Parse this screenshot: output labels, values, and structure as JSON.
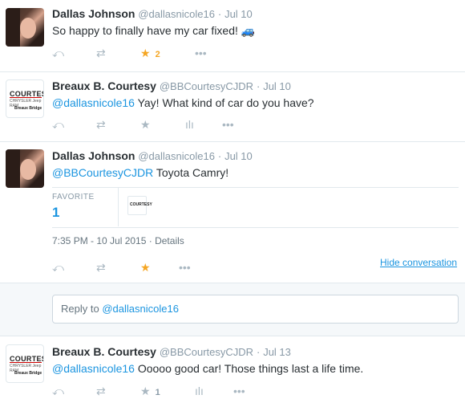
{
  "tweets": [
    {
      "name": "Dallas Johnson",
      "handle": "@dallasnicole16",
      "date": "Jul 10",
      "text": "So happy to finally have my car fixed! 🚙",
      "fav_count": "2"
    },
    {
      "name": "Breaux B. Courtesy",
      "handle": "@BBCourtesyCJDR",
      "date": "Jul 10",
      "mention": "@dallasnicole16",
      "text": "Yay! What kind of car do you have?"
    },
    {
      "name": "Dallas Johnson",
      "handle": "@dallasnicole16",
      "date": "Jul 10",
      "mention": "@BBCourtesyCJDR",
      "text": "Toyota Camry!",
      "stats_label": "FAVORITE",
      "stats_value": "1",
      "timestamp": "7:35 PM - 10 Jul 2015",
      "details_label": "Details",
      "hide_conversation": "Hide conversation"
    },
    {
      "name": "Breaux B. Courtesy",
      "handle": "@BBCourtesyCJDR",
      "date": "Jul 13",
      "mention": "@dallasnicole16",
      "text": "Ooooo good car! Those things last a life time.",
      "fav_count": "1"
    }
  ],
  "reply": {
    "prefix": "Reply to",
    "mention": "@dallasnicole16"
  },
  "avatar_text": {
    "logo_word": "COURTESY",
    "brand_line": "CHRYSLER Jeep RAM",
    "location": "Breaux Bridge"
  },
  "icons": {
    "reply": "reply-icon",
    "retweet": "retweet-icon",
    "favorite": "star-icon",
    "analytics": "analytics-icon",
    "more": "more-icon"
  },
  "colors": {
    "accent": "#1b95e0",
    "favorite": "#f5a623",
    "icon_grey": "#aab8c2"
  }
}
